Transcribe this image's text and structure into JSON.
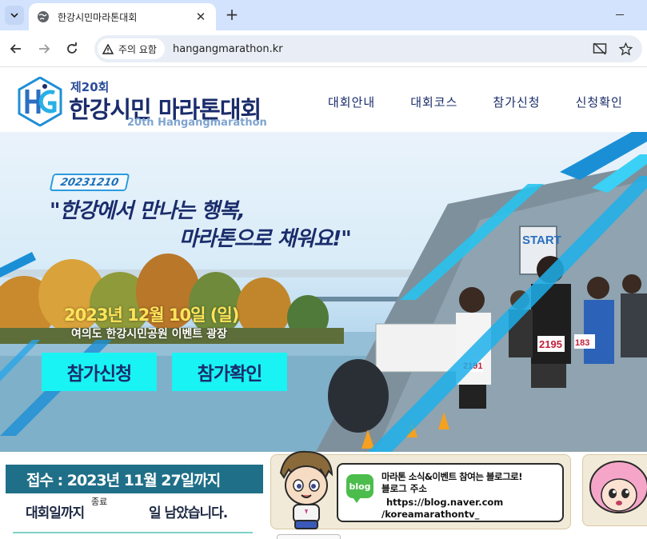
{
  "browser": {
    "tab_title": "한강시민마라톤대회",
    "tab_close": "✕",
    "new_tab": "+",
    "security_chip": "주의 요함",
    "url": "hangangmarathon.kr"
  },
  "site": {
    "logo_small": "제20회",
    "logo_main": "한강시민 마라톤대회",
    "logo_sub": "20th Hangangmarathon",
    "menu": [
      "대회안내",
      "대회코스",
      "참가신청",
      "신청확인"
    ]
  },
  "hero": {
    "date_tag": "20231210",
    "slogan_line1": "\"한강에서 만나는 행복,",
    "slogan_line2": "마라톤으로 채워요!\"",
    "event_date": "2023년 12월 10일 (일)",
    "event_place": "여의도 한강시민공원 이벤트 광장",
    "apply_button": "참가신청",
    "check_button": "참가확인",
    "start_banner": "START",
    "bibs": [
      "2195",
      "2195",
      "183",
      "2191"
    ]
  },
  "notice": {
    "deadline": "접수 : 2023년 11월 27일까지",
    "countdown_left": "대회일까지",
    "countdown_status": "종료",
    "countdown_right": "일 남았습니다."
  },
  "blog": {
    "icon_label": "blog",
    "line1": "마라톤 소식&이벤트 참여는 블로그로!",
    "line2": "블로그 주소",
    "line3": "https://blog.naver.com",
    "line4": "/koreamarathontv_"
  },
  "colors": {
    "tabbar": "#d3e3fd",
    "brand_navy": "#1a2c6b",
    "cyan_button": "#19f3f3",
    "date_yellow": "#ffe35a",
    "notice_teal": "#1f6f88"
  }
}
